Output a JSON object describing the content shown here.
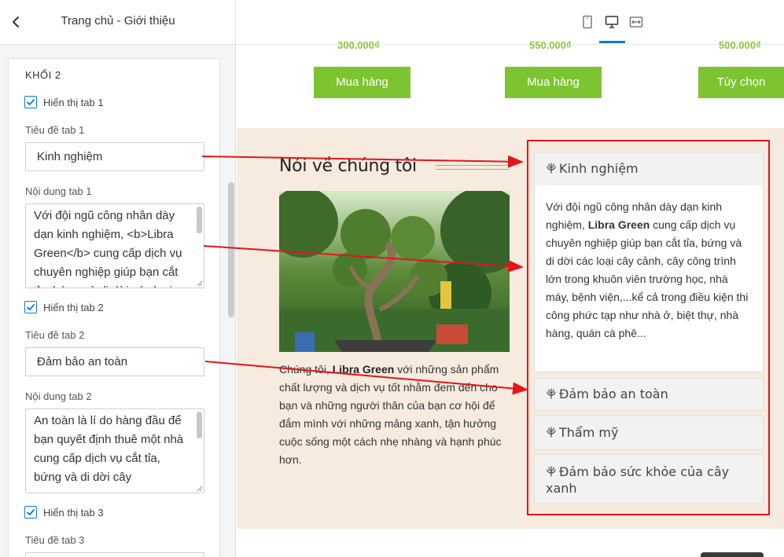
{
  "panel": {
    "title": "Trang chủ - Giới thiệu",
    "block_title": "KHỐI 2",
    "show_tab1_label": "Hiển thị tab 1",
    "tab1_title_label": "Tiêu đề tab 1",
    "tab1_title_value": "Kinh nghiệm",
    "tab1_content_label": "Nội dung tab 1",
    "tab1_content_value": "Với đội ngũ công nhân dày dạn kinh nghiệm, <b>Libra Green</b> cung cấp dịch vụ chuyên nghiệp giúp bạn cắt tỉa, bứng và di dời các loại cây cảnh",
    "show_tab2_label": "Hiển thị tab 2",
    "tab2_title_label": "Tiêu đề tab 2",
    "tab2_title_value": "Đảm bảo an toàn",
    "tab2_content_label": "Nội dung tab 2",
    "tab2_content_value": "An toàn là lí do hàng đầu để bạn quyết định thuê một nhà cung cấp dịch vụ cắt tỉa, bứng và di dời cây",
    "show_tab3_label": "Hiển thị tab 3",
    "tab3_title_label": "Tiêu đề tab 3"
  },
  "preview": {
    "prices": [
      "300.000₫",
      "550.000₫",
      "500.000₫"
    ],
    "buy_button": "Mua hàng",
    "option_button": "Tùy chọn",
    "about_title": "Nói về chúng tôi",
    "about_text_pre": "Chúng tôi, ",
    "about_text_brand": "Libra Green",
    "about_text_post": " với những sản phẩm chất lượng và dịch vụ tốt nhằm đem đến cho bạn và những người thân của bạn cơ hội để đắm mình với những mảng xanh, tận hưởng cuộc sống một cách nhẹ nhàng và hạnh phúc hơn.",
    "tabs": [
      "Kinh nghiệm",
      "Đảm bảo an toàn",
      "Thẩm mỹ",
      "Đảm bảo sức khỏe của cây xanh"
    ],
    "tab1_body_pre": "Với đội ngũ công nhân dày dạn kinh nghiệm, ",
    "tab1_body_brand": "Libra Green",
    "tab1_body_post": " cung cấp dịch vụ chuyên nghiệp giúp bạn cắt tỉa, bứng và di dời các loại cây cảnh, cây công trình lớn trong khuôn viên trường học, nhà máy, bệnh viện,...kể cả trong điều kiện thi công phức tạp như nhà ở, biệt thự, nhà hàng, quán cà phê..."
  },
  "colors": {
    "accent": "#0a7bd5",
    "button_green": "#7dc431",
    "price_green": "#8dc63f",
    "section_bg": "#f7ebdf",
    "annotation_red": "#e3151a"
  },
  "icons": [
    "chevron-left-icon",
    "checkmark-icon",
    "mobile-icon",
    "desktop-icon",
    "fit-width-icon",
    "leaf-icon"
  ]
}
